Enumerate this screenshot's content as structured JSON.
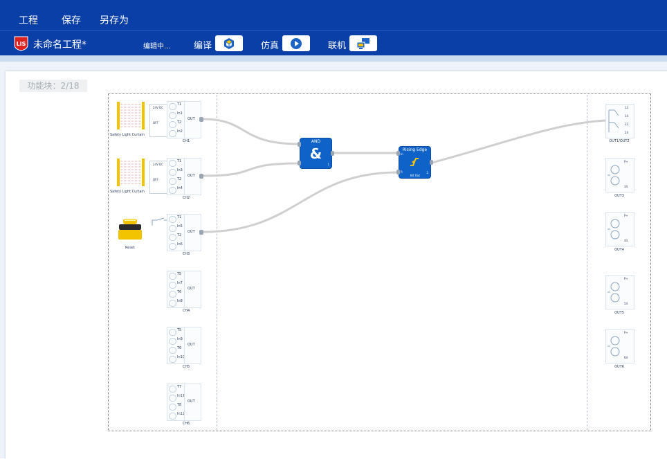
{
  "menu": {
    "project": "工程",
    "save": "保存",
    "save_as": "另存为"
  },
  "toolbar": {
    "title": "未命名工程*",
    "status": "编辑中...",
    "compile": "编译",
    "simulate": "仿真",
    "online": "联机"
  },
  "counter": "功能块：2/18",
  "inputs": {
    "ch1": {
      "pins": [
        "T1",
        "In1",
        "T2",
        "In2"
      ],
      "out": "OUT",
      "name": "CH1"
    },
    "ch2": {
      "pins": [
        "T1",
        "In3",
        "T2",
        "In4"
      ],
      "out": "OUT",
      "name": "CH2"
    },
    "ch3": {
      "pins": [
        "T1",
        "In5",
        "T2",
        "In6"
      ],
      "out": "OUT",
      "name": "CH3"
    },
    "ch4": {
      "pins": [
        "T5",
        "In7",
        "T6",
        "In8"
      ],
      "out": "OUT",
      "name": "CH4"
    },
    "ch5": {
      "pins": [
        "T5",
        "In9",
        "T6",
        "In10"
      ],
      "out": "OUT",
      "name": "CH5"
    },
    "ch6": {
      "pins": [
        "T7",
        "In11",
        "T8",
        "In12"
      ],
      "out": "OUT",
      "name": "CH6"
    }
  },
  "devices": {
    "curtain1": "Safety Light Curtain",
    "curtain2": "Safety Light Curtain",
    "reset": "Reset",
    "switch_top": "24V DC",
    "switch_mid": "OFF"
  },
  "blocks": {
    "and": {
      "title": "AND",
      "pin_out": "1"
    },
    "edge": {
      "title": "Rising Edge",
      "pin_in": "In",
      "pin_r": "R",
      "pin_out": "2",
      "sub": "Bit Out"
    }
  },
  "outputs": {
    "out12": {
      "terms": [
        "13",
        "14",
        "23",
        "24"
      ],
      "name": "OUT1/OUT2"
    },
    "out3": {
      "top": "P+",
      "bottom": "34",
      "name": "OUT3"
    },
    "out4": {
      "top": "P+",
      "bottom": "44",
      "name": "OUT4"
    },
    "out5": {
      "top": "P+",
      "bottom": "54",
      "name": "OUT5"
    },
    "out6": {
      "top": "P+",
      "bottom": "64",
      "name": "OUT6"
    }
  },
  "colors": {
    "header": "#0a3fa8",
    "block": "#0f63c8",
    "wire": "#cfcfcf",
    "curtain": "#f2c400"
  }
}
